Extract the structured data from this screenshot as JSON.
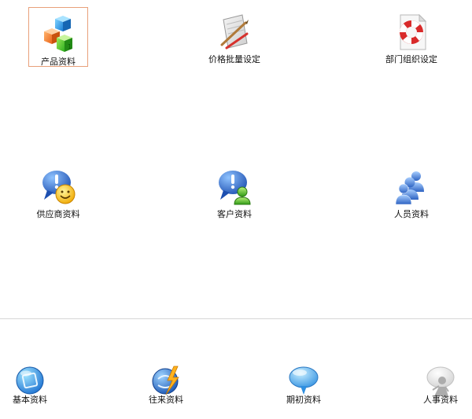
{
  "main": {
    "tiles": [
      {
        "label": "产品资料",
        "icon": "product-cubes-icon"
      },
      {
        "label": "价格批量设定",
        "icon": "price-tools-icon"
      },
      {
        "label": "部门组织设定",
        "icon": "lifebuoy-icon"
      },
      {
        "label": "供应商资料",
        "icon": "supplier-chat-smiley-icon"
      },
      {
        "label": "客户资料",
        "icon": "customer-chat-user-icon"
      },
      {
        "label": "人员资料",
        "icon": "people-group-icon"
      }
    ]
  },
  "bottom": {
    "items": [
      {
        "label": "基本资料",
        "icon": "basic-data-icon"
      },
      {
        "label": "往来资料",
        "icon": "transactions-lightning-icon"
      },
      {
        "label": "期初资料",
        "icon": "opening-bubble-icon"
      },
      {
        "label": "人事资料",
        "icon": "hr-person-icon"
      }
    ]
  }
}
